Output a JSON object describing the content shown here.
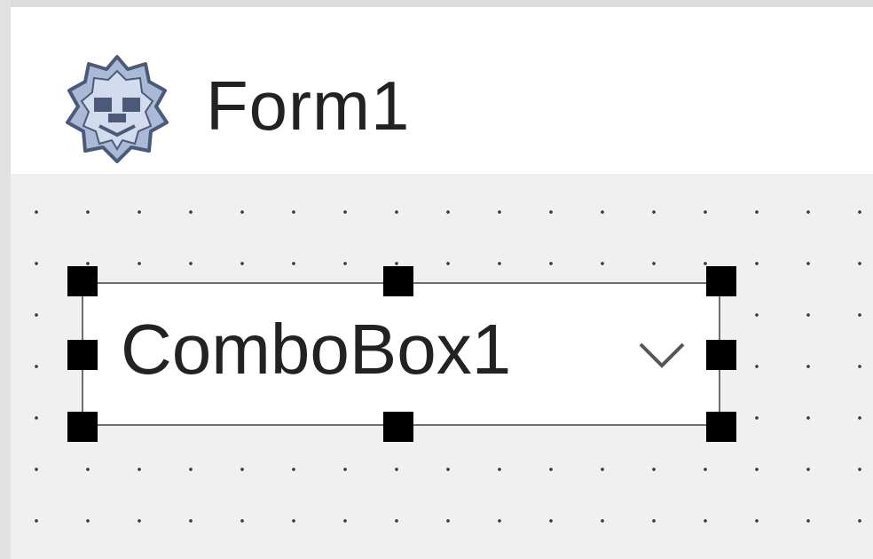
{
  "form": {
    "title": "Form1",
    "icon": "delphi-form-icon"
  },
  "combobox": {
    "text": "ComboBox1",
    "arrow_icon": "chevron-down-icon",
    "selected": true
  },
  "design_surface": {
    "grid": true
  }
}
